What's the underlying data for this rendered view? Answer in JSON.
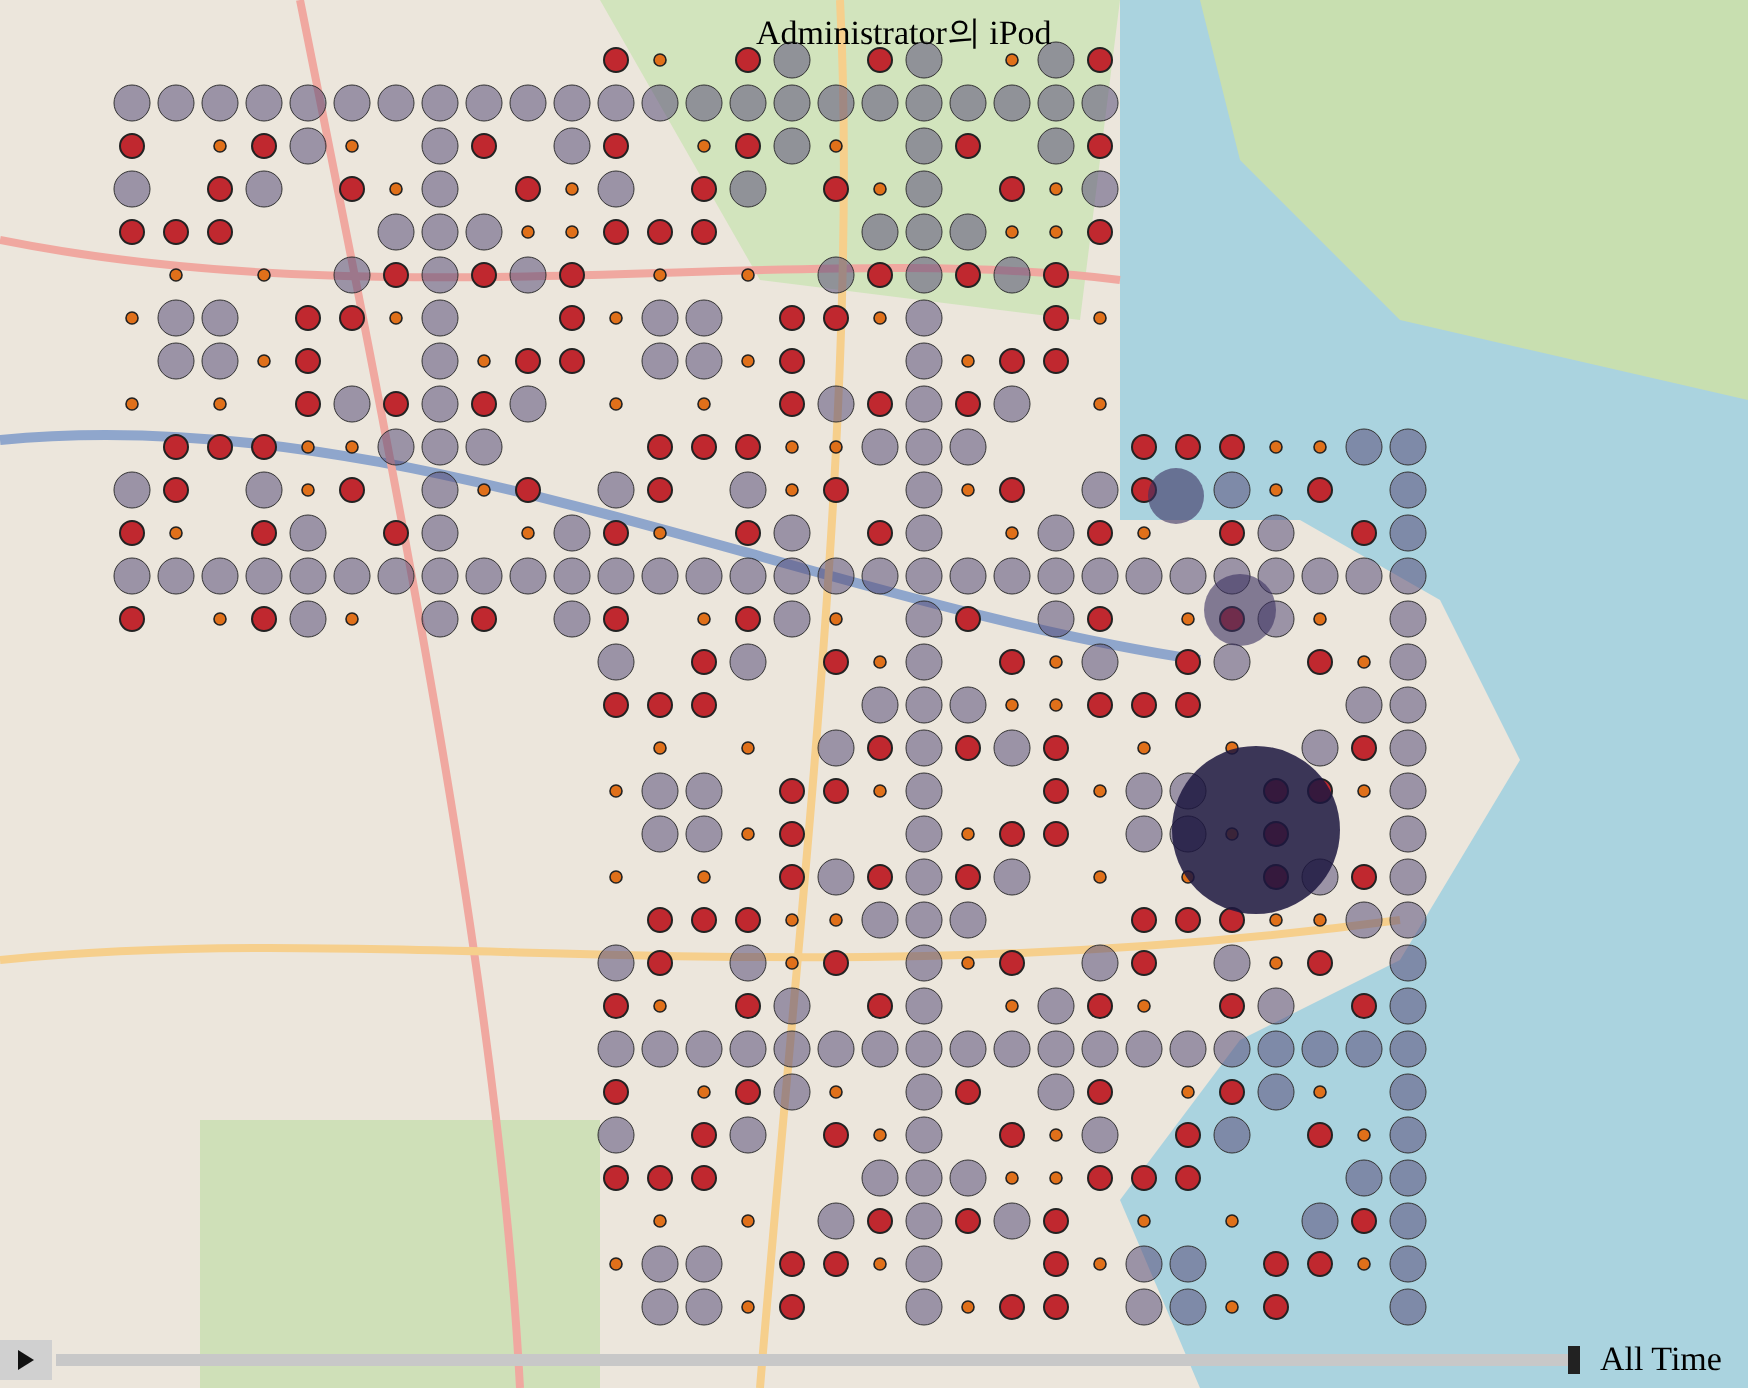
{
  "title": "Administrator의 iPod",
  "timeline": {
    "level": 1.0,
    "label": "All Time"
  }
}
